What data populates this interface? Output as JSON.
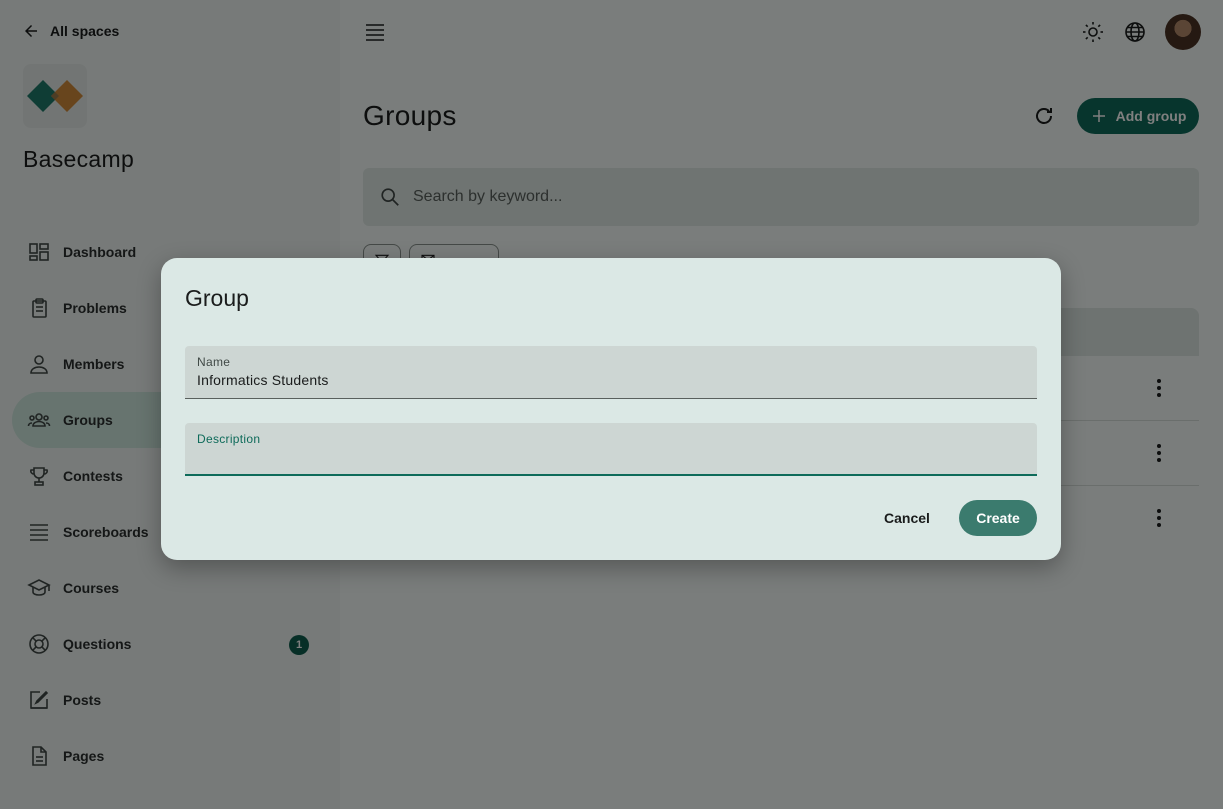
{
  "sidebar": {
    "back_label": "All spaces",
    "space_title": "Basecamp",
    "items": [
      {
        "label": "Dashboard",
        "icon": "dashboard-icon"
      },
      {
        "label": "Problems",
        "icon": "clipboard-icon"
      },
      {
        "label": "Members",
        "icon": "person-icon"
      },
      {
        "label": "Groups",
        "icon": "groups-icon",
        "active": true
      },
      {
        "label": "Contests",
        "icon": "trophy-icon"
      },
      {
        "label": "Scoreboards",
        "icon": "list-icon"
      },
      {
        "label": "Courses",
        "icon": "school-icon"
      },
      {
        "label": "Questions",
        "icon": "support-icon",
        "badge": "1"
      },
      {
        "label": "Posts",
        "icon": "edit-icon"
      },
      {
        "label": "Pages",
        "icon": "page-icon"
      }
    ]
  },
  "header": {
    "page_title": "Groups",
    "add_label": "Add group"
  },
  "search": {
    "placeholder": "Search by keyword..."
  },
  "dialog": {
    "title": "Group",
    "name_label": "Name",
    "name_value": "Informatics Students",
    "description_label": "Description",
    "description_value": "",
    "cancel_label": "Cancel",
    "create_label": "Create"
  },
  "colors": {
    "primary": "#0e6b5a",
    "create_button": "#3b7b6e",
    "badge": "#0e5e4f"
  }
}
